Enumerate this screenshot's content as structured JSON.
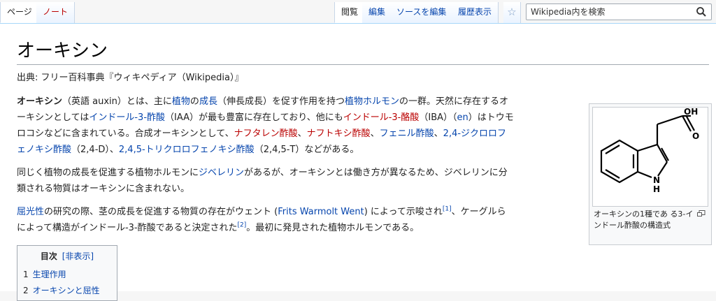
{
  "tabs": {
    "page": "ページ",
    "talk": "ノート",
    "read": "閲覧",
    "edit": "編集",
    "edit_source": "ソースを編集",
    "history": "履歴表示"
  },
  "search": {
    "placeholder": "Wikipedia内を検索"
  },
  "article": {
    "title": "オーキシン",
    "site_sub": "出典: フリー百科事典『ウィキペディア（Wikipedia）』",
    "p1": {
      "t0": "オーキシン",
      "t1": "（英語 auxin）とは、主に",
      "l1": "植物",
      "t2": "の",
      "l2": "成長",
      "t3": "（伸長成長）を促す作用を持つ",
      "l3": "植物ホルモン",
      "t4": "の一群。天然に存在するオ",
      "t5": "ーキシンとしては",
      "l4": "インドール-3-酢酸",
      "t6": "（IAA）が最も豊富に存在しており、他にも",
      "r1": "インドール-3-酪酸",
      "t7": "（IBA）（",
      "l5": "en",
      "t8": "）はトウモ",
      "t9": "ロコシなどに含まれている。合成オーキシンとして、",
      "r2": "ナフタレン酢酸",
      "t10": "、",
      "r3": "ナフトキシ酢酸",
      "t11": "、",
      "l6": "フェニル酢酸",
      "t12": "、",
      "l7a": "2,4-ジクロロフ",
      "l7b": "ェノキシ酢酸",
      "t13": "（2,4-D）、",
      "l8": "2,4,5-トリクロロフェノキシ酢酸",
      "t14": "（2,4,5-T）などがある。"
    },
    "p2": {
      "t0": "同じく植物の成長を促進する植物ホルモンに",
      "l1": "ジベレリン",
      "t1": "があるが、オーキシンとは働き方が異なるため、ジベレリンに分",
      "t2": "類される物質はオーキシンに含まれない。"
    },
    "p3": {
      "l1": "屈光性",
      "t0": "の研究の際、茎の成長を促進する物質の存在がウェント (",
      "l2": "Frits Warmolt Went",
      "t1": ") によって示唆され",
      "ref1": "[1]",
      "t2": "、ケーグルら",
      "t3": "によって構造がインドール-3-酢酸であると決定された",
      "ref2": "[2]",
      "t4": "。最初に発見された植物ホルモンである。"
    }
  },
  "figure": {
    "oh_label": "OH",
    "o_label": "O",
    "n_label": "N",
    "h_label": "H",
    "caption": "オーキシンの1種であ る3-インドール酢酸の構造式",
    "icons": [
      "magnify-clip-icon"
    ]
  },
  "toc": {
    "title": "目次",
    "toggle": "[非表示]",
    "items": [
      {
        "num": "1",
        "label": "生理作用"
      },
      {
        "num": "2",
        "label": "オーキシンと屈性"
      }
    ]
  },
  "colors": {
    "link": "#0645ad",
    "redlink": "#ba0000"
  }
}
